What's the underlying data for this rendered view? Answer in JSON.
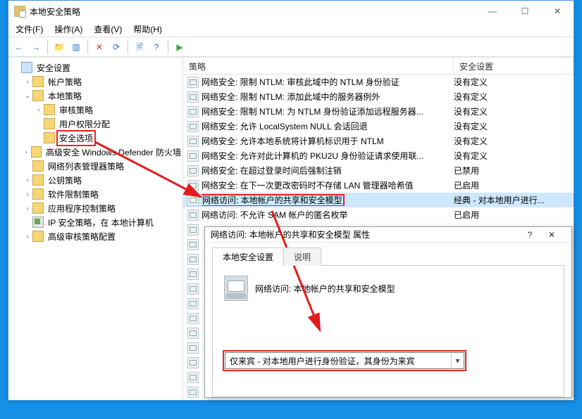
{
  "window": {
    "title": "本地安全策略",
    "buttons": {
      "min": "—",
      "max": "☐",
      "close": "✕"
    }
  },
  "menu": {
    "file": "文件(F)",
    "action": "操作(A)",
    "view": "查看(V)",
    "help": "帮助(H)"
  },
  "toolbar": {
    "back": "←",
    "forward": "→",
    "up": "⇧",
    "show": "☰",
    "delete": "✕",
    "refresh": "⟳",
    "export": "⤓",
    "help": "?",
    "play": "▸"
  },
  "tree": {
    "root": "安全设置",
    "nodes": [
      {
        "label": "帐户策略",
        "expand": ">",
        "indent": 1,
        "icon": "folder"
      },
      {
        "label": "本地策略",
        "expand": "v",
        "indent": 1,
        "icon": "folder"
      },
      {
        "label": "审核策略",
        "expand": ">",
        "indent": 2,
        "icon": "folder"
      },
      {
        "label": "用户权限分配",
        "expand": "",
        "indent": 2,
        "icon": "folder"
      },
      {
        "label": "安全选项",
        "expand": "",
        "indent": 2,
        "icon": "folder",
        "highlight": true
      },
      {
        "label": "高级安全 Windows Defender 防火墙",
        "expand": ">",
        "indent": 1,
        "icon": "folder"
      },
      {
        "label": "网络列表管理器策略",
        "expand": "",
        "indent": 1,
        "icon": "folder"
      },
      {
        "label": "公钥策略",
        "expand": ">",
        "indent": 1,
        "icon": "folder"
      },
      {
        "label": "软件限制策略",
        "expand": ">",
        "indent": 1,
        "icon": "folder"
      },
      {
        "label": "应用程序控制策略",
        "expand": ">",
        "indent": 1,
        "icon": "folder"
      },
      {
        "label": "IP 安全策略，在 本地计算机",
        "expand": "",
        "indent": 1,
        "icon": "ip"
      },
      {
        "label": "高级审核策略配置",
        "expand": ">",
        "indent": 1,
        "icon": "folder"
      }
    ]
  },
  "list": {
    "col_policy": "策略",
    "col_setting": "安全设置",
    "rows": [
      {
        "p": "网络安全: 限制 NTLM: 审核此域中的 NTLM 身份验证",
        "s": "没有定义"
      },
      {
        "p": "网络安全: 限制 NTLM: 添加此域中的服务器例外",
        "s": "没有定义"
      },
      {
        "p": "网络安全: 限制 NTLM: 为 NTLM 身份验证添加远程服务器...",
        "s": "没有定义"
      },
      {
        "p": "网络安全: 允许 LocalSystem NULL 会话回退",
        "s": "没有定义"
      },
      {
        "p": "网络安全: 允许本地系统将计算机标识用于 NTLM",
        "s": "没有定义"
      },
      {
        "p": "网络安全: 允许对此计算机的 PKU2U 身份验证请求使用联...",
        "s": "没有定义"
      },
      {
        "p": "网络安全: 在超过登录时间后强制注销",
        "s": "已禁用"
      },
      {
        "p": "网络安全: 在下一次更改密码时不存储 LAN 管理器哈希值",
        "s": "已启用"
      },
      {
        "p": "网络访问: 本地帐户的共享和安全模型",
        "s": "经典 - 对本地用户进行...",
        "highlight": true,
        "selected": true
      },
      {
        "p": "网络访问: 不允许 SAM 帐户的匿名枚举",
        "s": "已启用"
      }
    ],
    "extra_count": 12
  },
  "dialog": {
    "title": "网络访问: 本地帐户的共享和安全模型 属性",
    "help": "?",
    "close": "✕",
    "tab1": "本地安全设置",
    "tab2": "说明",
    "policy_label": "网络访问: 本地帐户的共享和安全模型",
    "combo_value": "仅来宾 - 对本地用户进行身份验证，其身份为来宾"
  },
  "annotations": {
    "arrow_color": "#e41b1b"
  }
}
